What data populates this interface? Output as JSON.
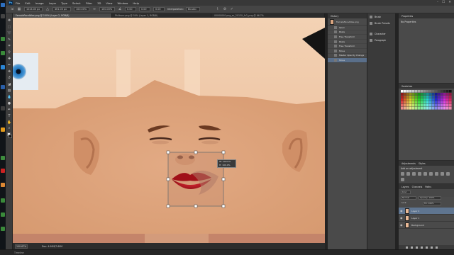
{
  "app": {
    "logo": "Ps",
    "menus": [
      "File",
      "Edit",
      "Image",
      "Layer",
      "Type",
      "Select",
      "Filter",
      "3D",
      "View",
      "Window",
      "Help"
    ],
    "window_controls": [
      "–",
      "☐",
      "✕"
    ]
  },
  "options_bar": {
    "x_value": "1024.00 px",
    "y_value": "461.00 px",
    "w_value": "100.00%",
    "h_value": "100.00%",
    "angle_value": "0.00",
    "h_skew": "0.00",
    "v_skew": "0.00",
    "interpolation_label": "Interpolation:",
    "interpolation_value": "Bicubic"
  },
  "document_tabs": [
    {
      "label": "FemaleFaceAtlas.png @ 100% (Layer 2, RGB/8)",
      "active": true
    },
    {
      "label": "Philtrum.png @ 50% (Layer 1, RGB/8)",
      "active": false
    },
    {
      "label": "00000000.png_sc_2013X_fx3_png @ 66.7%",
      "active": false
    }
  ],
  "canvas": {
    "transform_tip_line1": "W: 100.0%",
    "transform_tip_line2": "H: 100.0%"
  },
  "status_bar": {
    "zoom": "100.67%",
    "doc_info": "Doc: 4.00M/7.60M"
  },
  "timeline_label": "Timeline",
  "history_panel": {
    "tabs": [
      "History"
    ],
    "snapshot_label": "FemaleFaceAtlas.png",
    "items": [
      {
        "label": "Open",
        "active": false
      },
      {
        "label": "Paste",
        "active": false
      },
      {
        "label": "Free Transform",
        "active": false
      },
      {
        "label": "Paste",
        "active": false
      },
      {
        "label": "Free Transform",
        "active": false
      },
      {
        "label": "Move",
        "active": false
      },
      {
        "label": "Master Opacity Change",
        "active": false
      },
      {
        "label": "Move",
        "active": true
      }
    ]
  },
  "icon_strip": {
    "items": [
      "Brush",
      "Brush Presets",
      "Character",
      "Paragraph"
    ]
  },
  "properties_panel": {
    "tab": "Properties",
    "empty_text": "No Properties"
  },
  "swatches_panel": {
    "tab": "Swatches"
  },
  "adjustments_panel": {
    "tabs": [
      "Adjustments",
      "Styles"
    ],
    "add_label": "Add an adjustment"
  },
  "layers_panel": {
    "tabs": [
      "Layers",
      "Channels",
      "Paths"
    ],
    "kind_filter": "Kind",
    "blend_mode": "Normal",
    "opacity": "Opacity: 100%",
    "lock_label": "Lock:",
    "fill": "Fill: 100%",
    "layers": [
      {
        "name": "Layer 2",
        "active": true
      },
      {
        "name": "Layer 1",
        "active": false
      },
      {
        "name": "Background",
        "active": false
      }
    ]
  },
  "colors": {
    "skin": "#efc6a4",
    "lips": "#b8141c",
    "iris": "#1c70b8",
    "selection": "#5f7590"
  }
}
